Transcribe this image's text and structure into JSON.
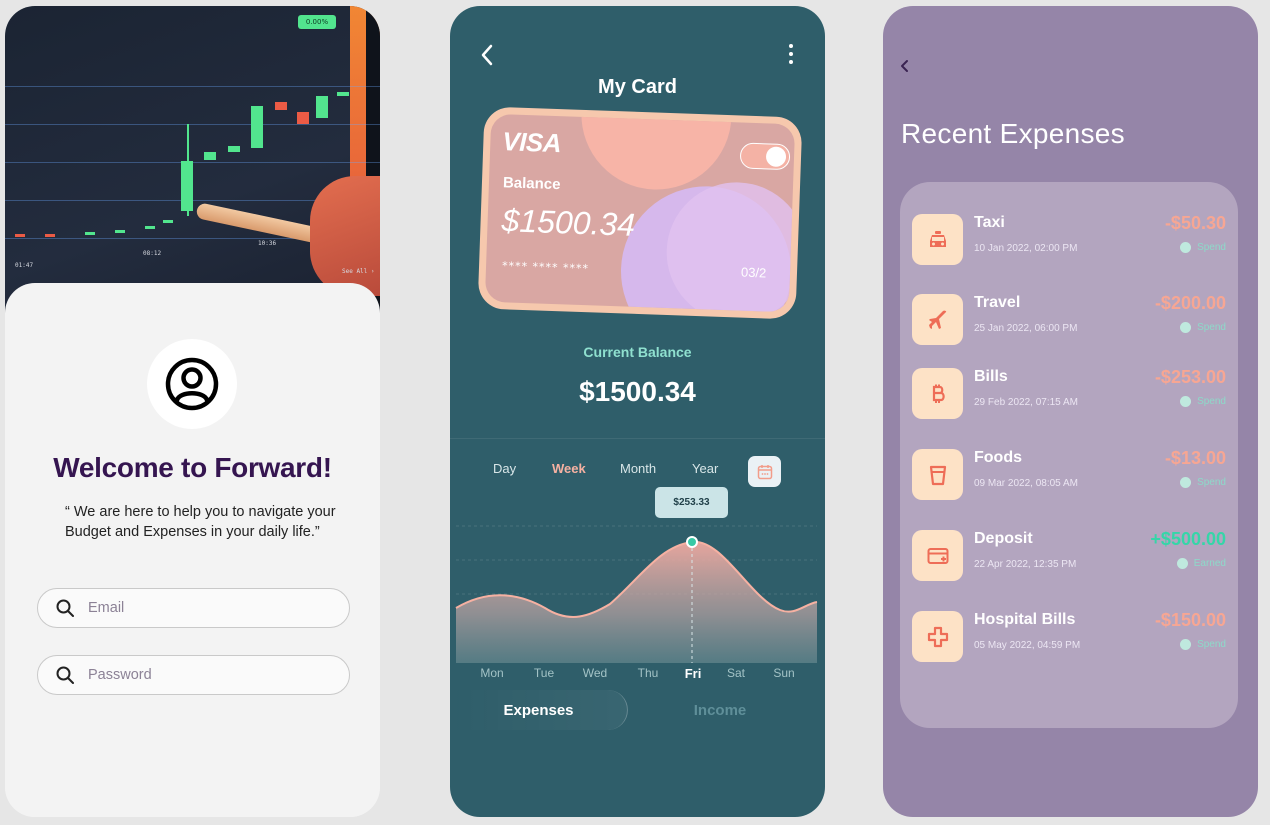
{
  "login": {
    "photo_badge": "0.00%",
    "chart_ticks": [
      "01:47",
      "08:12",
      "10:36",
      "See All ›"
    ],
    "welcome": "Welcome to Forward!",
    "quote": "“ We are here to help you to navigate your Budget and Expenses in your  daily life.”",
    "email_placeholder": "Email",
    "password_placeholder": "Password",
    "icons": {
      "avatar": "user-circle-icon",
      "search": "search-icon"
    }
  },
  "card_screen": {
    "title": "My Card",
    "card": {
      "brand": "VISA",
      "balance_label": "Balance",
      "balance": "$1500.34",
      "number": "**** **** ****",
      "expiry": "03/2",
      "toggle_on": true
    },
    "current_balance_label": "Current Balance",
    "current_balance": "$1500.34",
    "periods": [
      "Day",
      "Week",
      "Month",
      "Year"
    ],
    "selected_period": "Week",
    "tooltip": "$253.33",
    "days": [
      "Mon",
      "Tue",
      "Wed",
      "Thu",
      "Fri",
      "Sat",
      "Sun"
    ],
    "selected_day": "Fri",
    "tabs": {
      "expenses": "Expenses",
      "income": "Income"
    },
    "colors": {
      "background": "#2f5e6a",
      "accent": "#f6b1a2",
      "teal": "#8fe0cf"
    }
  },
  "expenses_screen": {
    "title": "Recent Expenses",
    "items": [
      {
        "name": "Taxi",
        "date": "10 Jan 2022, 02:00 PM",
        "amount": "-$50.30",
        "status": "Spend",
        "icon": "taxi-icon"
      },
      {
        "name": "Travel",
        "date": "25 Jan 2022, 06:00 PM",
        "amount": "-$200.00",
        "status": "Spend",
        "icon": "airplane-icon"
      },
      {
        "name": "Bills",
        "date": "29 Feb 2022, 07:15 AM",
        "amount": "-$253.00",
        "status": "Spend",
        "icon": "bitcoin-icon"
      },
      {
        "name": "Foods",
        "date": "09 Mar 2022, 08:05 AM",
        "amount": "-$13.00",
        "status": "Spend",
        "icon": "cup-icon"
      },
      {
        "name": "Deposit",
        "date": "22 Apr 2022, 12:35 PM",
        "amount": "+$500.00",
        "status": "Earned",
        "icon": "card-icon"
      },
      {
        "name": "Hospital Bills",
        "date": "05 May 2022, 04:59 PM",
        "amount": "-$150.00",
        "status": "Spend",
        "icon": "medical-cross-icon"
      }
    ],
    "colors": {
      "background": "#9585a8",
      "negative": "#f7a693",
      "positive": "#35d6a8",
      "icon_bg": "#fde2c6"
    }
  }
}
